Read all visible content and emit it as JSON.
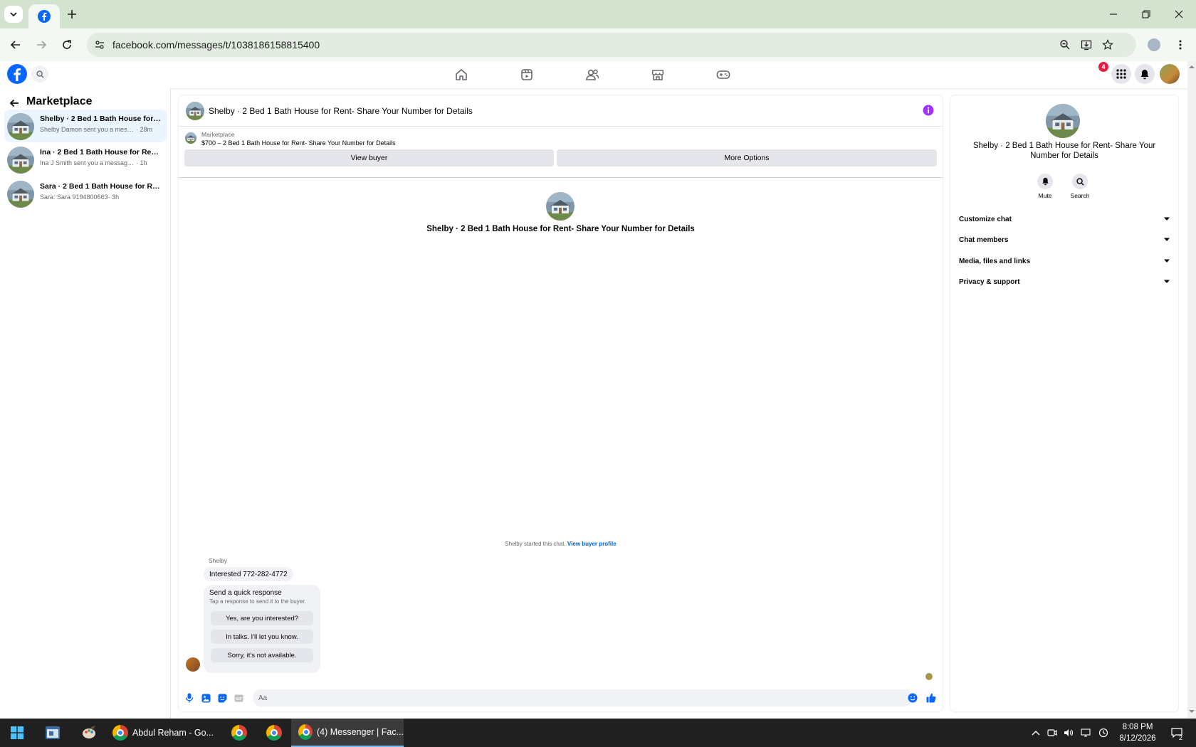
{
  "browser": {
    "url": "facebook.com/messages/t/1038186158815400"
  },
  "header": {
    "notification_count": "4"
  },
  "sidebar": {
    "title": "Marketplace",
    "conversations": [
      {
        "title": "Shelby · 2 Bed 1 Bath House for Re...",
        "preview": "Shelby Damon sent you a message ...",
        "time": "· 28m",
        "active": true
      },
      {
        "title": "Ina · 2 Bed 1 Bath House for Rent- ...",
        "preview": "Ina J Smith sent you a message about ...",
        "time": "· 1h",
        "active": false
      },
      {
        "title": "Sara · 2 Bed 1 Bath House for Rent...",
        "preview": "Sara: Sara 9194800663",
        "time": "· 3h",
        "active": false
      }
    ]
  },
  "chat": {
    "title": "Shelby · 2 Bed 1 Bath House for Rent- Share Your Number for Details",
    "listing_label": "Marketplace",
    "listing_title": "$700 – 2 Bed 1 Bath House for Rent- Share Your Number for Details",
    "view_buyer_label": "View buyer",
    "more_options_label": "More Options",
    "center_title": "Shelby · 2 Bed 1 Bath House for Rent- Share Your Number for Details",
    "started_text": "Shelby started this chat.",
    "view_profile_link": "View buyer profile",
    "sender_name": "Shelby",
    "message": "Interested 772-282-4772",
    "quick_response": {
      "title": "Send a quick response",
      "subtitle": "Tap a response to send it to the buyer.",
      "options": [
        "Yes, are you interested?",
        "In talks. I'll let you know.",
        "Sorry, it's not available."
      ]
    },
    "composer_placeholder": "Aa"
  },
  "details": {
    "title": "Shelby · 2 Bed 1 Bath House for Rent- Share Your Number for Details",
    "mute_label": "Mute",
    "search_label": "Search",
    "sections": [
      "Customize chat",
      "Chat members",
      "Media, files and links",
      "Privacy & support"
    ]
  },
  "taskbar": {
    "item1_label": "Abdul Reham - Go...",
    "item2_label": "(4) Messenger | Fac...",
    "time": "8:08 PM",
    "date": "8/12/2026",
    "notification_count": "2"
  },
  "colors": {
    "facebook_blue": "#0866ff",
    "accent_purple": "#a033ff",
    "notification_red": "#e41e3f"
  }
}
